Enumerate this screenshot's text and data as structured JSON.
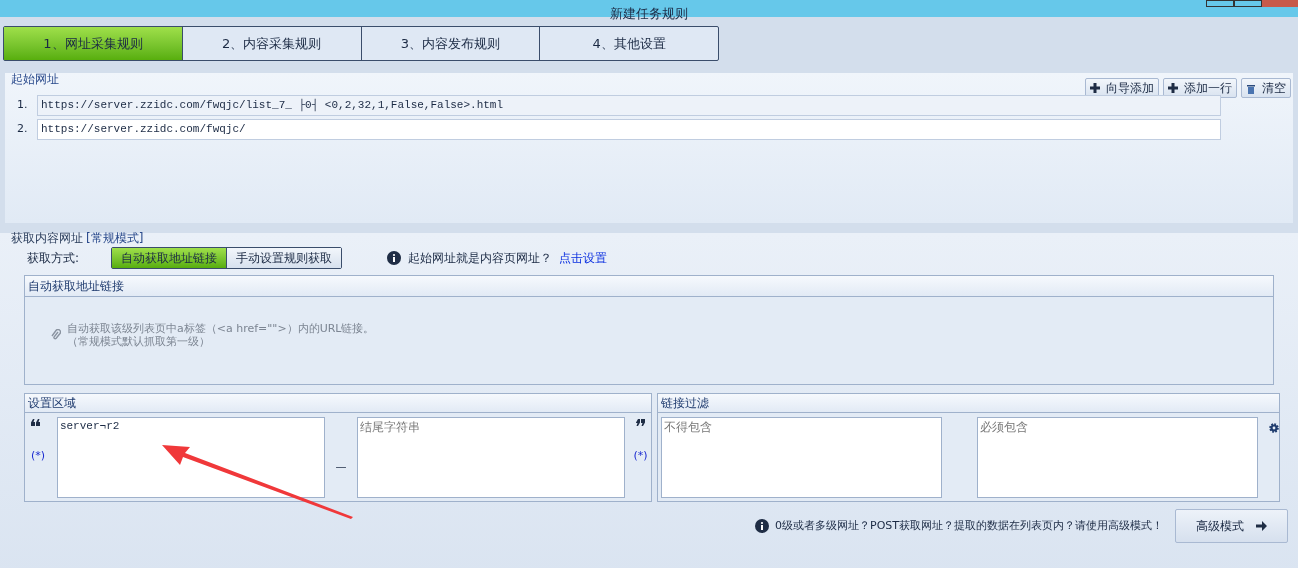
{
  "window": {
    "title": "新建任务规则"
  },
  "steps": [
    {
      "label": "1、网址采集规则",
      "selected": true
    },
    {
      "label": "2、内容采集规则",
      "selected": false
    },
    {
      "label": "3、内容发布规则",
      "selected": false
    },
    {
      "label": "4、其他设置",
      "selected": false
    }
  ],
  "start_urls": {
    "title": "起始网址",
    "buttons": [
      {
        "label": "向导添加",
        "kind": "plus"
      },
      {
        "label": "添加一行",
        "kind": "plus"
      },
      {
        "label": "清空",
        "kind": "trash"
      }
    ],
    "rows": [
      {
        "index": "1.",
        "value": "https://server.zzidc.com/fwqjc/list_7_ ├0┤ <0,2,32,1,False,False>.html",
        "selected": true
      },
      {
        "index": "2.",
        "value": "https://server.zzidc.com/fwqjc/",
        "selected": false
      }
    ]
  },
  "content_urls": {
    "title": "获取内容网址",
    "mode": "[常规模式]",
    "method_label": "获取方式:",
    "methods": [
      {
        "label": "自动获取地址链接",
        "selected": true
      },
      {
        "label": "手动设置规则获取",
        "selected": false
      }
    ],
    "hint": "起始网址就是内容页网址？",
    "hint_link": "点击设置",
    "auto_panel": {
      "title": "自动获取地址链接",
      "lines": [
        "自动获取该级列表页中a标签（<a href=\"\">）内的URL链接。",
        "（常规模式默认抓取第一级）"
      ]
    },
    "region": {
      "title": "设置区域",
      "wildcard_left": "(*)",
      "separator": "—",
      "wildcard_right": "(*)",
      "start_value": "server¬r2",
      "end_placeholder": "结尾字符串"
    },
    "filter": {
      "title": "链接过滤",
      "exclude_placeholder": "不得包含",
      "include_placeholder": "必须包含"
    },
    "footer": {
      "hint": "0级或者多级网址？POST获取网址？提取的数据在列表页内？请使用高级模式！",
      "button": "高级模式"
    }
  }
}
